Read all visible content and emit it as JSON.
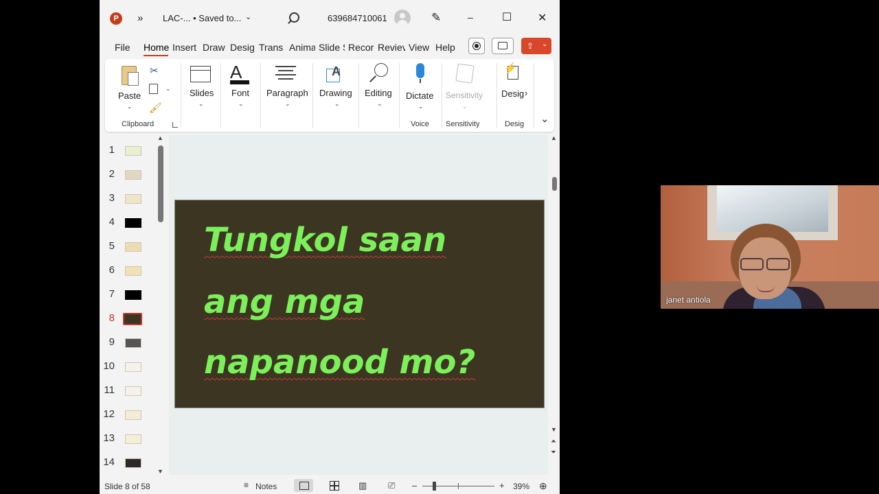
{
  "titlebar": {
    "app_icon": "powerpoint-logo",
    "overflow": "»",
    "doc_title": "LAC-...  • Saved to...",
    "account": "639684710061",
    "search_icon": "search-icon",
    "minimize": "–",
    "maximize": "☐",
    "close": "✕"
  },
  "menu": {
    "items": [
      "File",
      "Home",
      "Insert",
      "Draw",
      "Desig",
      "Transi",
      "Anima",
      "Slide S",
      "Recor",
      "Reviev",
      "View",
      "Help"
    ],
    "active": "Home"
  },
  "ribbon": {
    "paste": "Paste",
    "clipboard_group": "Clipboard",
    "slides": "Slides",
    "font": "Font",
    "paragraph": "Paragraph",
    "drawing": "Drawing",
    "editing": "Editing",
    "dictate": "Dictate",
    "voice_group": "Voice",
    "sensitivity": "Sensitivity",
    "sensitivity_group": "Sensitivity",
    "designer": "Desig",
    "designer_group": "Desig",
    "more_arrow": "›",
    "collapse": "⌄"
  },
  "thumbnails": {
    "numbers": [
      "1",
      "2",
      "3",
      "4",
      "5",
      "6",
      "7",
      "8",
      "9",
      "10",
      "11",
      "12",
      "13",
      "14"
    ],
    "selected": "8",
    "selected_color": "#c0392b"
  },
  "slide": {
    "lines": [
      "Tungkol saan",
      "ang mga",
      "napanood mo?"
    ],
    "text_color": "#7cf05a",
    "background": "#3c3522"
  },
  "statusbar": {
    "slide_info": "Slide 8 of 58",
    "notes": "Notes",
    "zoom_minus": "–",
    "zoom_plus": "+",
    "zoom": "39%"
  },
  "video": {
    "name": "janet antiola"
  }
}
